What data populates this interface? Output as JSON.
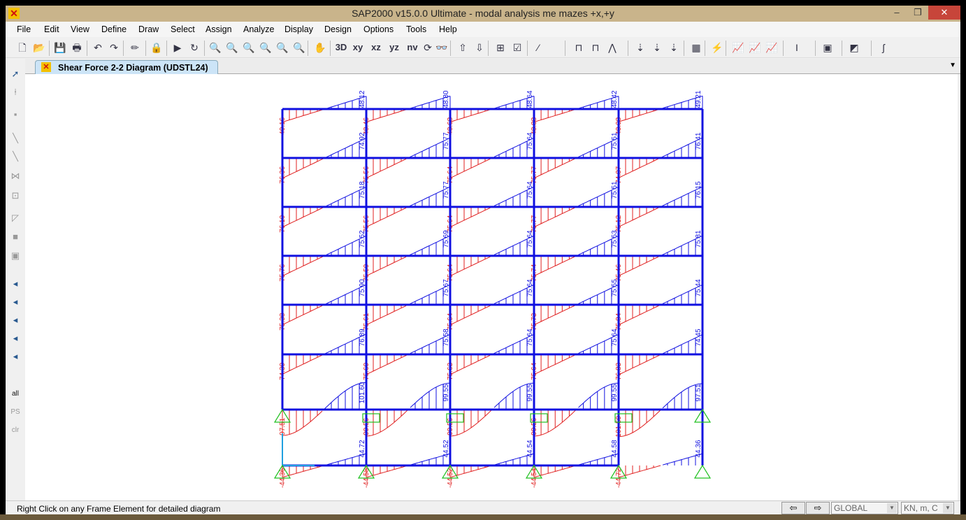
{
  "window": {
    "title": "SAP2000 v15.0.0 Ultimate  - modal analysis me mazes +x,+y",
    "minimize": "–",
    "restore": "❐",
    "close": "✕"
  },
  "menu": [
    "File",
    "Edit",
    "View",
    "Define",
    "Draw",
    "Select",
    "Assign",
    "Analyze",
    "Display",
    "Design",
    "Options",
    "Tools",
    "Help"
  ],
  "toolbar": {
    "view_labels": [
      "3D",
      "xy",
      "xz",
      "yz",
      "nv"
    ]
  },
  "tab": {
    "label": "Shear Force 2-2 Diagram   (UDSTL24)"
  },
  "left_toolbar": {
    "labels": [
      "all",
      "PS",
      "clr"
    ]
  },
  "status": {
    "text": "Right Click on any Frame Element for detailed diagram",
    "coord_system": "GLOBAL",
    "units": "KN, m, C"
  },
  "colors": {
    "frame": "#1010e0",
    "negative": "#e02020",
    "positive": "#1010e0",
    "support": "#20c020",
    "axes": "#20a0e0"
  },
  "diagram": {
    "type": "shear-force-2-2",
    "bays": 5,
    "levels": [
      {
        "shape": "linear",
        "left": [
          "-49.16",
          "-48.46",
          "-48.68",
          "-48.88",
          "-48.08"
        ],
        "right": [
          "48.12",
          "48.80",
          "48.64",
          "48.42",
          "49.21"
        ]
      },
      {
        "shape": "linear",
        "left": [
          "-76.36",
          "-75.56",
          "-75.64",
          "-75.77",
          "-74.87"
        ],
        "right": [
          "74.92",
          "75.77",
          "75.64",
          "75.51",
          "76.41"
        ]
      },
      {
        "shape": "linear",
        "left": [
          "-76.10",
          "-75.56",
          "-75.64",
          "-75.77",
          "-75.12"
        ],
        "right": [
          "75.18",
          "75.77",
          "75.64",
          "75.51",
          "76.15"
        ]
      },
      {
        "shape": "linear",
        "left": [
          "-75.76",
          "-75.59",
          "-75.64",
          "-75.74",
          "-75.46"
        ],
        "right": [
          "75.52",
          "75.69",
          "75.64",
          "75.53",
          "75.81"
        ]
      },
      {
        "shape": "linear",
        "left": [
          "-75.38",
          "-75.61",
          "-75.64",
          "-75.73",
          "-75.84"
        ],
        "right": [
          "75.90",
          "75.67",
          "75.64",
          "75.55",
          "75.44"
        ]
      },
      {
        "shape": "linear",
        "left": [
          "-74.39",
          "-75.69",
          "-75.63",
          "-75.64",
          "-76.83"
        ],
        "right": [
          "76.89",
          "75.58",
          "75.64",
          "75.64",
          "74.45"
        ]
      },
      {
        "shape": "curve",
        "left": [
          "-97.51",
          "-99.56",
          "-99.56",
          "-99.56",
          "-101.59"
        ],
        "right": [
          "101.60",
          "99.55",
          "99.55",
          "99.55",
          "97.51"
        ]
      },
      {
        "shape": "linear",
        "left": [
          "-44.36",
          "-44.58",
          "-44.52",
          "-44.54",
          "-44.72"
        ],
        "right": [
          "44.72",
          "44.52",
          "44.54",
          "44.58",
          "44.36"
        ]
      }
    ]
  }
}
